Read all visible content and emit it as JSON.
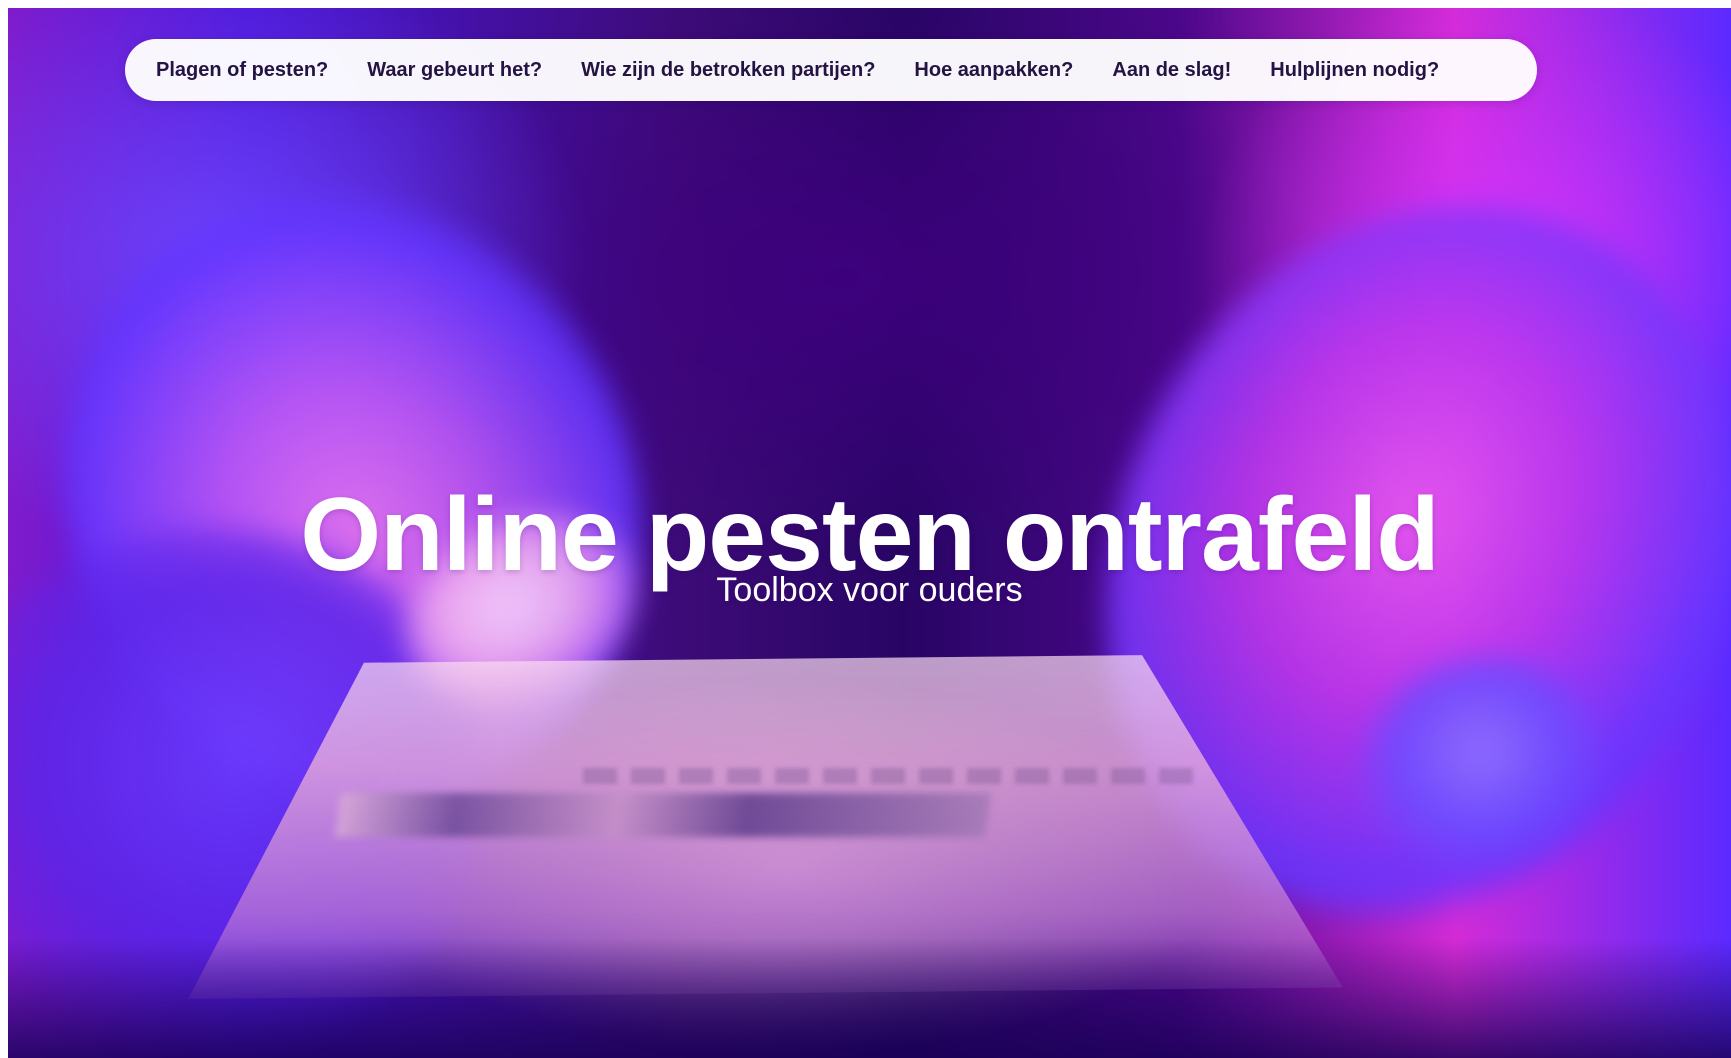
{
  "navigation": {
    "items": [
      {
        "label": "Plagen of pesten?"
      },
      {
        "label": "Waar gebeurt het?"
      },
      {
        "label": "Wie zijn de betrokken partijen?"
      },
      {
        "label": "Hoe aanpakken?"
      },
      {
        "label": "Aan de slag!"
      },
      {
        "label": "Hulplijnen nodig?"
      }
    ]
  },
  "hero": {
    "title": "Online pesten ontrafeld",
    "subtitle": "Toolbox voor ouders"
  },
  "colors": {
    "nav_text": "#241343",
    "hero_text": "#ffffff",
    "accent_purple": "#5b2aff",
    "accent_magenta": "#d42bd6"
  }
}
